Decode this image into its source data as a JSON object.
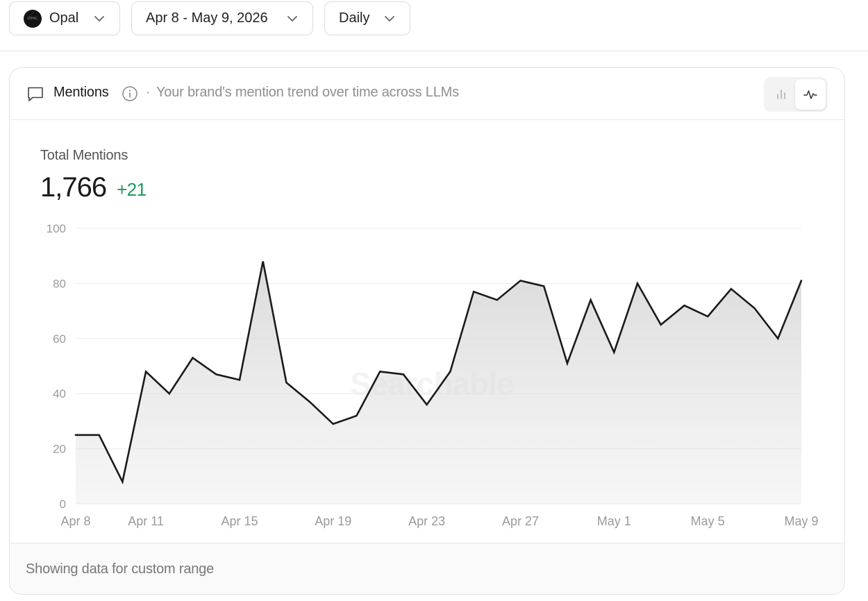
{
  "filters": {
    "brand": {
      "label": "Opal",
      "logo_text": "OPAL"
    },
    "date_range": {
      "label": "Apr 8 - May 9, 2026"
    },
    "granularity": {
      "label": "Daily"
    }
  },
  "card": {
    "title": "Mentions",
    "separator": "·",
    "description": "Your brand's mention trend over time across LLMs",
    "view_toggle": {
      "options": [
        "bar-chart-icon",
        "line-chart-icon"
      ],
      "active": "line-chart-icon"
    },
    "kpi": {
      "label": "Total Mentions",
      "value": "1,766",
      "delta": "+21"
    },
    "watermark": "Searchable",
    "footer": "Showing data for custom range"
  },
  "colors": {
    "positive": "#1e9a5e",
    "line": "#1a1a1a",
    "grid": "#ececec",
    "axis_text": "#9a9a9a"
  },
  "chart_data": {
    "type": "area",
    "x": [
      "Apr 8",
      "Apr 9",
      "Apr 10",
      "Apr 11",
      "Apr 12",
      "Apr 13",
      "Apr 14",
      "Apr 15",
      "Apr 16",
      "Apr 17",
      "Apr 18",
      "Apr 19",
      "Apr 20",
      "Apr 21",
      "Apr 22",
      "Apr 23",
      "Apr 24",
      "Apr 25",
      "Apr 26",
      "Apr 27",
      "Apr 28",
      "Apr 29",
      "Apr 30",
      "May 1",
      "May 2",
      "May 3",
      "May 4",
      "May 5",
      "May 6",
      "May 7",
      "May 8",
      "May 9"
    ],
    "values": [
      25,
      25,
      8,
      48,
      40,
      53,
      47,
      45,
      88,
      44,
      37,
      29,
      32,
      48,
      47,
      36,
      48,
      77,
      74,
      81,
      79,
      51,
      74,
      55,
      80,
      65,
      72,
      68,
      78,
      71,
      60,
      81
    ],
    "x_tick_labels": [
      "Apr 8",
      "Apr 11",
      "Apr 15",
      "Apr 19",
      "Apr 23",
      "Apr 27",
      "May 1",
      "May 5",
      "May 9"
    ],
    "y_ticks": [
      0,
      20,
      40,
      60,
      80,
      100
    ],
    "ylim": [
      0,
      100
    ],
    "grid": true,
    "title": "",
    "xlabel": "",
    "ylabel": ""
  }
}
